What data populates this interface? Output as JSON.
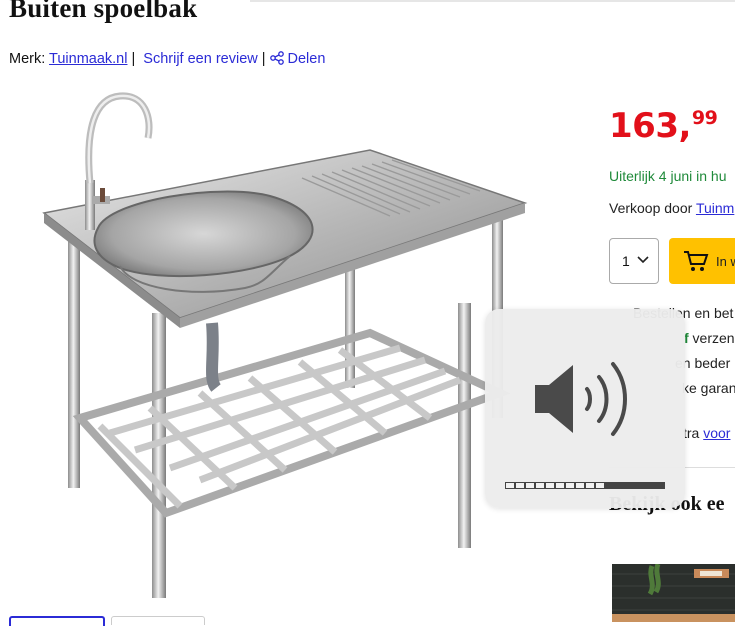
{
  "product": {
    "title": "Buiten spoelbak",
    "brand_label": "Merk:",
    "brand_link": "Tuinmaak.nl",
    "separator": "|",
    "review_link": "Schrijf een review",
    "share_link": "Delen"
  },
  "offer": {
    "price_whole": "163,",
    "price_cents": "99",
    "delivery": "Uiterlijk 4 juni in hu",
    "seller_label": "Verkoop door",
    "seller_link": "Tuinm",
    "quantity": "1",
    "cart_label": "In w"
  },
  "usps": {
    "line1": "Bestellen en bet",
    "line2_green": "f",
    "line2_rest": " verzen",
    "line3": "en beder",
    "line4": "ke garan",
    "line5_prefix": "tra ",
    "line5_link": "voor"
  },
  "related": {
    "heading": "Bekijk ook ee"
  },
  "volume_osd": {
    "level_fraction": 0.6,
    "segments": 16,
    "icon": "speaker-volume-icon"
  },
  "colors": {
    "price_red": "#e2101a",
    "link_blue": "#2b2bd6",
    "delivery_green": "#1f8a3a",
    "cart_yellow": "#ffc100"
  }
}
